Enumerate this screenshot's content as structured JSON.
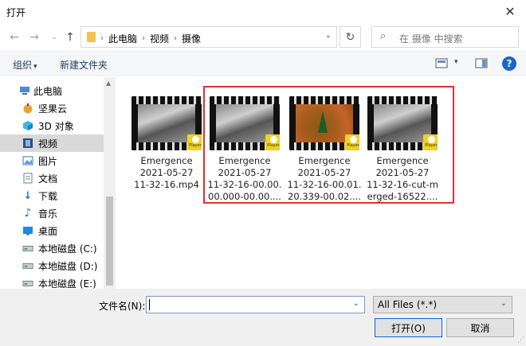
{
  "window": {
    "title": "打开"
  },
  "nav": {
    "breadcrumbs": [
      "此电脑",
      "视频",
      "摄像"
    ],
    "search_placeholder": "在 摄像 中搜索"
  },
  "toolbar": {
    "organize": "组织",
    "new_folder": "新建文件夹"
  },
  "sidebar": {
    "items": [
      {
        "label": "此电脑",
        "icon": "pc-icon"
      },
      {
        "label": "坚果云",
        "icon": "nutstore-icon"
      },
      {
        "label": "3D 对象",
        "icon": "3d-objects-icon"
      },
      {
        "label": "视频",
        "icon": "videos-icon",
        "selected": true
      },
      {
        "label": "图片",
        "icon": "pictures-icon"
      },
      {
        "label": "文档",
        "icon": "documents-icon"
      },
      {
        "label": "下载",
        "icon": "downloads-icon"
      },
      {
        "label": "音乐",
        "icon": "music-icon"
      },
      {
        "label": "桌面",
        "icon": "desktop-icon"
      },
      {
        "label": "本地磁盘 (C:)",
        "icon": "drive-icon"
      },
      {
        "label": "本地磁盘 (D:)",
        "icon": "drive-icon"
      },
      {
        "label": "本地磁盘 (E:)",
        "icon": "drive-icon"
      }
    ]
  },
  "files": [
    {
      "line1": "Emergence",
      "line2": "2021-05-27",
      "line3": "11-32-16.mp4",
      "line4": "",
      "thumb": "gray"
    },
    {
      "line1": "Emergence",
      "line2": "2021-05-27",
      "line3": "11-32-16-00.00.",
      "line4": "00.000-00.00....",
      "thumb": "gray"
    },
    {
      "line1": "Emergence",
      "line2": "2021-05-27",
      "line3": "11-32-16-00.01.",
      "line4": "20.339-00.02....",
      "thumb": "orange"
    },
    {
      "line1": "Emergence",
      "line2": "2021-05-27",
      "line3": "11-32-16-cut-m",
      "line4": "erged-16522....",
      "thumb": "gray"
    }
  ],
  "badge_text": "Player",
  "bottom": {
    "filename_label": "文件名(N):",
    "filename_value": "",
    "filter_value": "All Files (*.*)",
    "open_label": "打开(O)",
    "cancel_label": "取消"
  },
  "colors": {
    "highlight": "#e03131",
    "help": "#1a66c8",
    "folder": "#f2c14e"
  }
}
